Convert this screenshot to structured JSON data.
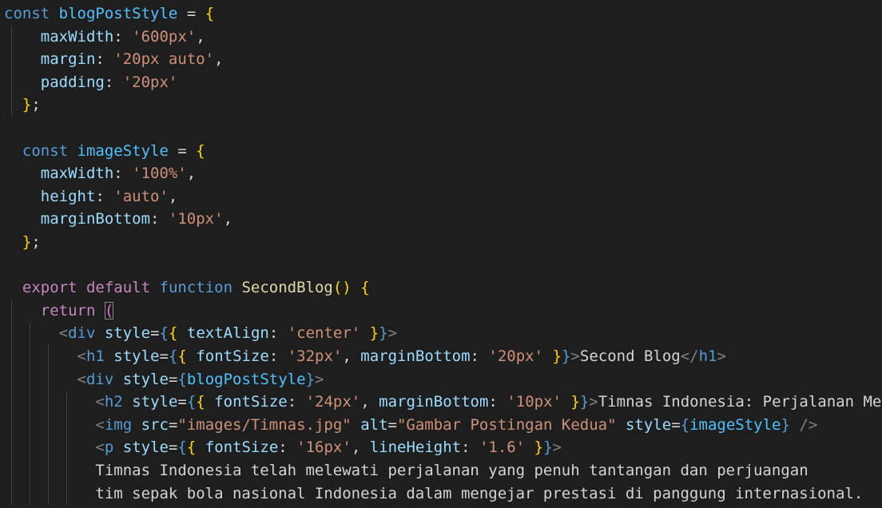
{
  "editor": {
    "theme": "dark",
    "background": "#1e1e1e",
    "indent_guide_color": "#404040",
    "colors": {
      "keyword": "#569cd6",
      "control": "#c586c0",
      "variable": "#9cdcfe",
      "constant": "#4fc1ff",
      "function": "#dcdcaa",
      "string": "#ce9178",
      "text": "#d4d4d4",
      "brace1": "#ffd700",
      "brace2": "#da70d6",
      "brace3": "#179fff",
      "tag_bracket": "#808080"
    },
    "lines": [
      {
        "indent": 0,
        "tokens": [
          {
            "t": "const",
            "c": "keyword"
          },
          {
            "t": " ",
            "c": "text"
          },
          {
            "t": "blogPostStyle",
            "c": "constant"
          },
          {
            "t": " = ",
            "c": "text"
          },
          {
            "t": "{",
            "c": "brace1"
          }
        ]
      },
      {
        "indent": 2,
        "tokens": [
          {
            "t": "maxWidth",
            "c": "variable"
          },
          {
            "t": ": ",
            "c": "text"
          },
          {
            "t": "'600px'",
            "c": "string"
          },
          {
            "t": ",",
            "c": "text"
          }
        ]
      },
      {
        "indent": 2,
        "tokens": [
          {
            "t": "margin",
            "c": "variable"
          },
          {
            "t": ": ",
            "c": "text"
          },
          {
            "t": "'20px auto'",
            "c": "string"
          },
          {
            "t": ",",
            "c": "text"
          }
        ]
      },
      {
        "indent": 2,
        "tokens": [
          {
            "t": "padding",
            "c": "variable"
          },
          {
            "t": ": ",
            "c": "text"
          },
          {
            "t": "'20px'",
            "c": "string"
          }
        ]
      },
      {
        "indent": 1,
        "tokens": [
          {
            "t": "}",
            "c": "brace1"
          },
          {
            "t": ";",
            "c": "text"
          }
        ]
      },
      {
        "indent": 0,
        "tokens": []
      },
      {
        "indent": 1,
        "tokens": [
          {
            "t": "const",
            "c": "keyword"
          },
          {
            "t": " ",
            "c": "text"
          },
          {
            "t": "imageStyle",
            "c": "constant"
          },
          {
            "t": " = ",
            "c": "text"
          },
          {
            "t": "{",
            "c": "brace1"
          }
        ]
      },
      {
        "indent": 2,
        "tokens": [
          {
            "t": "maxWidth",
            "c": "variable"
          },
          {
            "t": ": ",
            "c": "text"
          },
          {
            "t": "'100%'",
            "c": "string"
          },
          {
            "t": ",",
            "c": "text"
          }
        ]
      },
      {
        "indent": 2,
        "tokens": [
          {
            "t": "height",
            "c": "variable"
          },
          {
            "t": ": ",
            "c": "text"
          },
          {
            "t": "'auto'",
            "c": "string"
          },
          {
            "t": ",",
            "c": "text"
          }
        ]
      },
      {
        "indent": 2,
        "tokens": [
          {
            "t": "marginBottom",
            "c": "variable"
          },
          {
            "t": ": ",
            "c": "text"
          },
          {
            "t": "'10px'",
            "c": "string"
          },
          {
            "t": ",",
            "c": "text"
          }
        ]
      },
      {
        "indent": 1,
        "tokens": [
          {
            "t": "}",
            "c": "brace1"
          },
          {
            "t": ";",
            "c": "text"
          }
        ]
      },
      {
        "indent": 0,
        "tokens": []
      },
      {
        "indent": 1,
        "tokens": [
          {
            "t": "export",
            "c": "control"
          },
          {
            "t": " ",
            "c": "text"
          },
          {
            "t": "default",
            "c": "control"
          },
          {
            "t": " ",
            "c": "text"
          },
          {
            "t": "function",
            "c": "keyword"
          },
          {
            "t": " ",
            "c": "text"
          },
          {
            "t": "SecondBlog",
            "c": "function"
          },
          {
            "t": "()",
            "c": "brace1"
          },
          {
            "t": " ",
            "c": "text"
          },
          {
            "t": "{",
            "c": "brace1"
          }
        ]
      },
      {
        "indent": 2,
        "tokens": [
          {
            "t": "return",
            "c": "control"
          },
          {
            "t": " ",
            "c": "text"
          },
          {
            "t": "(",
            "c": "brace2",
            "box": true
          }
        ]
      },
      {
        "indent": 3,
        "tokens": [
          {
            "t": "<",
            "c": "tag_bracket"
          },
          {
            "t": "div",
            "c": "keyword"
          },
          {
            "t": " ",
            "c": "text"
          },
          {
            "t": "style",
            "c": "variable"
          },
          {
            "t": "=",
            "c": "text"
          },
          {
            "t": "{",
            "c": "keyword"
          },
          {
            "t": "{",
            "c": "brace1"
          },
          {
            "t": " ",
            "c": "text"
          },
          {
            "t": "textAlign",
            "c": "variable"
          },
          {
            "t": ": ",
            "c": "text"
          },
          {
            "t": "'center'",
            "c": "string"
          },
          {
            "t": " ",
            "c": "text"
          },
          {
            "t": "}",
            "c": "brace1"
          },
          {
            "t": "}",
            "c": "keyword"
          },
          {
            "t": ">",
            "c": "tag_bracket"
          }
        ]
      },
      {
        "indent": 4,
        "tokens": [
          {
            "t": "<",
            "c": "tag_bracket"
          },
          {
            "t": "h1",
            "c": "keyword"
          },
          {
            "t": " ",
            "c": "text"
          },
          {
            "t": "style",
            "c": "variable"
          },
          {
            "t": "=",
            "c": "text"
          },
          {
            "t": "{",
            "c": "keyword"
          },
          {
            "t": "{",
            "c": "brace1"
          },
          {
            "t": " ",
            "c": "text"
          },
          {
            "t": "fontSize",
            "c": "variable"
          },
          {
            "t": ": ",
            "c": "text"
          },
          {
            "t": "'32px'",
            "c": "string"
          },
          {
            "t": ", ",
            "c": "text"
          },
          {
            "t": "marginBottom",
            "c": "variable"
          },
          {
            "t": ": ",
            "c": "text"
          },
          {
            "t": "'20px'",
            "c": "string"
          },
          {
            "t": " ",
            "c": "text"
          },
          {
            "t": "}",
            "c": "brace1"
          },
          {
            "t": "}",
            "c": "keyword"
          },
          {
            "t": ">",
            "c": "tag_bracket"
          },
          {
            "t": "Second Blog",
            "c": "text"
          },
          {
            "t": "</",
            "c": "tag_bracket"
          },
          {
            "t": "h1",
            "c": "keyword"
          },
          {
            "t": ">",
            "c": "tag_bracket"
          }
        ]
      },
      {
        "indent": 4,
        "tokens": [
          {
            "t": "<",
            "c": "tag_bracket"
          },
          {
            "t": "div",
            "c": "keyword"
          },
          {
            "t": " ",
            "c": "text"
          },
          {
            "t": "style",
            "c": "variable"
          },
          {
            "t": "=",
            "c": "text"
          },
          {
            "t": "{",
            "c": "keyword"
          },
          {
            "t": "blogPostStyle",
            "c": "constant"
          },
          {
            "t": "}",
            "c": "keyword"
          },
          {
            "t": ">",
            "c": "tag_bracket"
          }
        ]
      },
      {
        "indent": 5,
        "tokens": [
          {
            "t": "<",
            "c": "tag_bracket"
          },
          {
            "t": "h2",
            "c": "keyword"
          },
          {
            "t": " ",
            "c": "text"
          },
          {
            "t": "style",
            "c": "variable"
          },
          {
            "t": "=",
            "c": "text"
          },
          {
            "t": "{",
            "c": "keyword"
          },
          {
            "t": "{",
            "c": "brace1"
          },
          {
            "t": " ",
            "c": "text"
          },
          {
            "t": "fontSize",
            "c": "variable"
          },
          {
            "t": ": ",
            "c": "text"
          },
          {
            "t": "'24px'",
            "c": "string"
          },
          {
            "t": ", ",
            "c": "text"
          },
          {
            "t": "marginBottom",
            "c": "variable"
          },
          {
            "t": ": ",
            "c": "text"
          },
          {
            "t": "'10px'",
            "c": "string"
          },
          {
            "t": " ",
            "c": "text"
          },
          {
            "t": "}",
            "c": "brace1"
          },
          {
            "t": "}",
            "c": "keyword"
          },
          {
            "t": ">",
            "c": "tag_bracket"
          },
          {
            "t": "Timnas Indonesia: Perjalanan Me",
            "c": "text"
          }
        ]
      },
      {
        "indent": 5,
        "tokens": [
          {
            "t": "<",
            "c": "tag_bracket"
          },
          {
            "t": "img",
            "c": "keyword"
          },
          {
            "t": " ",
            "c": "text"
          },
          {
            "t": "src",
            "c": "variable"
          },
          {
            "t": "=",
            "c": "text"
          },
          {
            "t": "\"images/Timnas.jpg\"",
            "c": "string"
          },
          {
            "t": " ",
            "c": "text"
          },
          {
            "t": "alt",
            "c": "variable"
          },
          {
            "t": "=",
            "c": "text"
          },
          {
            "t": "\"Gambar Postingan Kedua\"",
            "c": "string"
          },
          {
            "t": " ",
            "c": "text"
          },
          {
            "t": "style",
            "c": "variable"
          },
          {
            "t": "=",
            "c": "text"
          },
          {
            "t": "{",
            "c": "keyword"
          },
          {
            "t": "imageStyle",
            "c": "constant"
          },
          {
            "t": "}",
            "c": "keyword"
          },
          {
            "t": " ",
            "c": "text"
          },
          {
            "t": "/>",
            "c": "tag_bracket"
          }
        ]
      },
      {
        "indent": 5,
        "tokens": [
          {
            "t": "<",
            "c": "tag_bracket"
          },
          {
            "t": "p",
            "c": "keyword"
          },
          {
            "t": " ",
            "c": "text"
          },
          {
            "t": "style",
            "c": "variable"
          },
          {
            "t": "=",
            "c": "text"
          },
          {
            "t": "{",
            "c": "keyword"
          },
          {
            "t": "{",
            "c": "brace1"
          },
          {
            "t": " ",
            "c": "text"
          },
          {
            "t": "fontSize",
            "c": "variable"
          },
          {
            "t": ": ",
            "c": "text"
          },
          {
            "t": "'16px'",
            "c": "string"
          },
          {
            "t": ", ",
            "c": "text"
          },
          {
            "t": "lineHeight",
            "c": "variable"
          },
          {
            "t": ": ",
            "c": "text"
          },
          {
            "t": "'1.6'",
            "c": "string"
          },
          {
            "t": " ",
            "c": "text"
          },
          {
            "t": "}",
            "c": "brace1"
          },
          {
            "t": "}",
            "c": "keyword"
          },
          {
            "t": ">",
            "c": "tag_bracket"
          }
        ]
      },
      {
        "indent": 5,
        "tokens": [
          {
            "t": "Timnas Indonesia telah melewati perjalanan yang penuh tantangan dan perjuangan",
            "c": "text"
          }
        ]
      },
      {
        "indent": 5,
        "tokens": [
          {
            "t": "tim sepak bola nasional Indonesia dalam mengejar prestasi di panggung internasional.",
            "c": "text"
          }
        ]
      }
    ]
  }
}
